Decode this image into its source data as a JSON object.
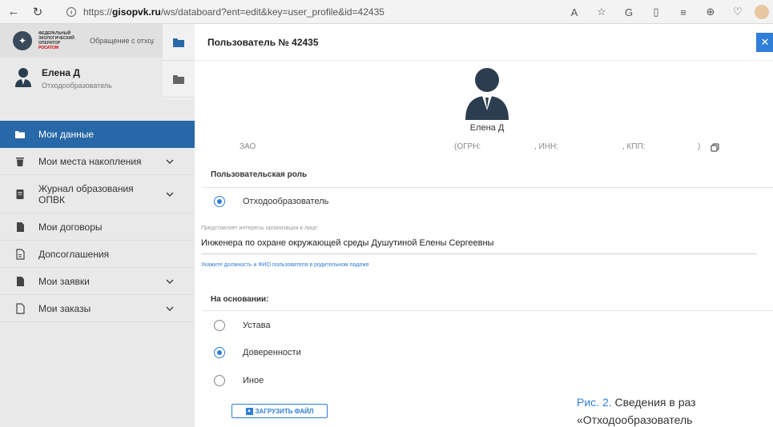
{
  "browser": {
    "url_prefix": "https://",
    "url_host": "gisopvk.ru",
    "url_path": "/ws/databoard?ent=edit&key=user_profile&id=42435"
  },
  "sidebar": {
    "logo_lines": [
      "ФЕДЕРАЛЬНЫЙ",
      "ЭКОЛОГИЧЕСКИЙ",
      "ОПЕРАТОР"
    ],
    "logo_brand": "РОСАТОМ",
    "notice": "Обращение с отход I и II классов опасн",
    "user_name": "Елена Д",
    "user_role": "Отходообразователь",
    "menu": [
      {
        "label": "Мои данные"
      },
      {
        "label": "Мои места накопления"
      },
      {
        "label": "Журнал образования ОПВК"
      },
      {
        "label": "Мои договоры"
      },
      {
        "label": "Допсоглашения"
      },
      {
        "label": "Мои заявки"
      },
      {
        "label": "Мои заказы"
      }
    ]
  },
  "panel": {
    "title": "Пользователь № 42435",
    "close_label": "✕",
    "user_name": "Елена Д",
    "org": {
      "type": "ЗАО",
      "ogrn": "(ОГРН:",
      "inn": ", ИНН:",
      "kpp": ", КПП:",
      "close_paren": ")"
    },
    "role_section": "Пользовательская роль",
    "role_option": "Отходообразователь",
    "represent_label": "Представляет интересы организации в лице:",
    "represent_value": "Инженера по охране окружающей среды Душутиной Елены Сергеевны",
    "represent_hint": "Укажите должность и ФИО пользователя в родительном падеже",
    "basis_section": "На основании:",
    "basis_options": [
      {
        "label": "Устава",
        "checked": false
      },
      {
        "label": "Доверенности",
        "checked": true
      },
      {
        "label": "Иное",
        "checked": false
      }
    ],
    "upload_label": "ЗАГРУЗИТЬ ФАЙЛ"
  },
  "caption": {
    "fig": "Рис. 2.",
    "text": " Сведения в раз",
    "line2": "«Отходообразователь"
  },
  "colors": {
    "accent": "#2f7ed8",
    "sidebar_active": "#2868a8"
  }
}
